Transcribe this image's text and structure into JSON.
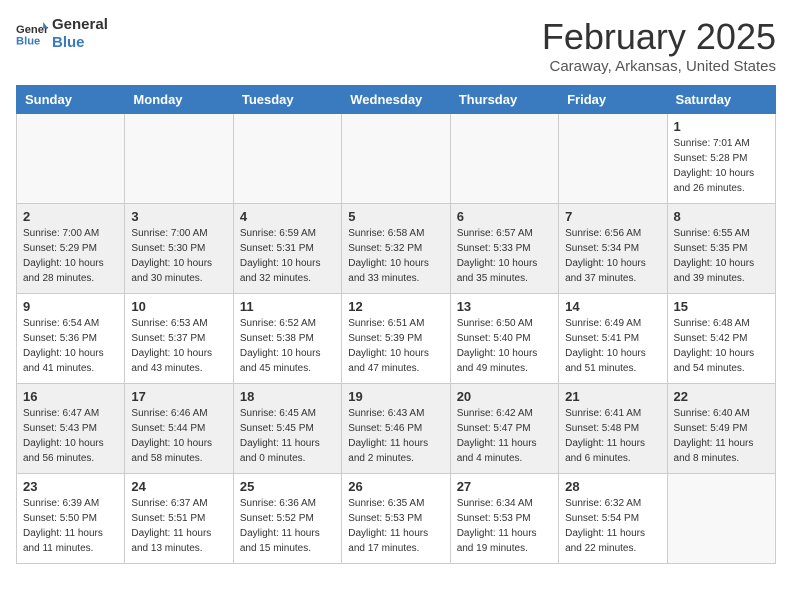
{
  "header": {
    "logo_line1": "General",
    "logo_line2": "Blue",
    "month_title": "February 2025",
    "location": "Caraway, Arkansas, United States"
  },
  "weekdays": [
    "Sunday",
    "Monday",
    "Tuesday",
    "Wednesday",
    "Thursday",
    "Friday",
    "Saturday"
  ],
  "weeks": [
    [
      {
        "day": "",
        "info": ""
      },
      {
        "day": "",
        "info": ""
      },
      {
        "day": "",
        "info": ""
      },
      {
        "day": "",
        "info": ""
      },
      {
        "day": "",
        "info": ""
      },
      {
        "day": "",
        "info": ""
      },
      {
        "day": "1",
        "info": "Sunrise: 7:01 AM\nSunset: 5:28 PM\nDaylight: 10 hours and 26 minutes."
      }
    ],
    [
      {
        "day": "2",
        "info": "Sunrise: 7:00 AM\nSunset: 5:29 PM\nDaylight: 10 hours and 28 minutes."
      },
      {
        "day": "3",
        "info": "Sunrise: 7:00 AM\nSunset: 5:30 PM\nDaylight: 10 hours and 30 minutes."
      },
      {
        "day": "4",
        "info": "Sunrise: 6:59 AM\nSunset: 5:31 PM\nDaylight: 10 hours and 32 minutes."
      },
      {
        "day": "5",
        "info": "Sunrise: 6:58 AM\nSunset: 5:32 PM\nDaylight: 10 hours and 33 minutes."
      },
      {
        "day": "6",
        "info": "Sunrise: 6:57 AM\nSunset: 5:33 PM\nDaylight: 10 hours and 35 minutes."
      },
      {
        "day": "7",
        "info": "Sunrise: 6:56 AM\nSunset: 5:34 PM\nDaylight: 10 hours and 37 minutes."
      },
      {
        "day": "8",
        "info": "Sunrise: 6:55 AM\nSunset: 5:35 PM\nDaylight: 10 hours and 39 minutes."
      }
    ],
    [
      {
        "day": "9",
        "info": "Sunrise: 6:54 AM\nSunset: 5:36 PM\nDaylight: 10 hours and 41 minutes."
      },
      {
        "day": "10",
        "info": "Sunrise: 6:53 AM\nSunset: 5:37 PM\nDaylight: 10 hours and 43 minutes."
      },
      {
        "day": "11",
        "info": "Sunrise: 6:52 AM\nSunset: 5:38 PM\nDaylight: 10 hours and 45 minutes."
      },
      {
        "day": "12",
        "info": "Sunrise: 6:51 AM\nSunset: 5:39 PM\nDaylight: 10 hours and 47 minutes."
      },
      {
        "day": "13",
        "info": "Sunrise: 6:50 AM\nSunset: 5:40 PM\nDaylight: 10 hours and 49 minutes."
      },
      {
        "day": "14",
        "info": "Sunrise: 6:49 AM\nSunset: 5:41 PM\nDaylight: 10 hours and 51 minutes."
      },
      {
        "day": "15",
        "info": "Sunrise: 6:48 AM\nSunset: 5:42 PM\nDaylight: 10 hours and 54 minutes."
      }
    ],
    [
      {
        "day": "16",
        "info": "Sunrise: 6:47 AM\nSunset: 5:43 PM\nDaylight: 10 hours and 56 minutes."
      },
      {
        "day": "17",
        "info": "Sunrise: 6:46 AM\nSunset: 5:44 PM\nDaylight: 10 hours and 58 minutes."
      },
      {
        "day": "18",
        "info": "Sunrise: 6:45 AM\nSunset: 5:45 PM\nDaylight: 11 hours and 0 minutes."
      },
      {
        "day": "19",
        "info": "Sunrise: 6:43 AM\nSunset: 5:46 PM\nDaylight: 11 hours and 2 minutes."
      },
      {
        "day": "20",
        "info": "Sunrise: 6:42 AM\nSunset: 5:47 PM\nDaylight: 11 hours and 4 minutes."
      },
      {
        "day": "21",
        "info": "Sunrise: 6:41 AM\nSunset: 5:48 PM\nDaylight: 11 hours and 6 minutes."
      },
      {
        "day": "22",
        "info": "Sunrise: 6:40 AM\nSunset: 5:49 PM\nDaylight: 11 hours and 8 minutes."
      }
    ],
    [
      {
        "day": "23",
        "info": "Sunrise: 6:39 AM\nSunset: 5:50 PM\nDaylight: 11 hours and 11 minutes."
      },
      {
        "day": "24",
        "info": "Sunrise: 6:37 AM\nSunset: 5:51 PM\nDaylight: 11 hours and 13 minutes."
      },
      {
        "day": "25",
        "info": "Sunrise: 6:36 AM\nSunset: 5:52 PM\nDaylight: 11 hours and 15 minutes."
      },
      {
        "day": "26",
        "info": "Sunrise: 6:35 AM\nSunset: 5:53 PM\nDaylight: 11 hours and 17 minutes."
      },
      {
        "day": "27",
        "info": "Sunrise: 6:34 AM\nSunset: 5:53 PM\nDaylight: 11 hours and 19 minutes."
      },
      {
        "day": "28",
        "info": "Sunrise: 6:32 AM\nSunset: 5:54 PM\nDaylight: 11 hours and 22 minutes."
      },
      {
        "day": "",
        "info": ""
      }
    ]
  ]
}
